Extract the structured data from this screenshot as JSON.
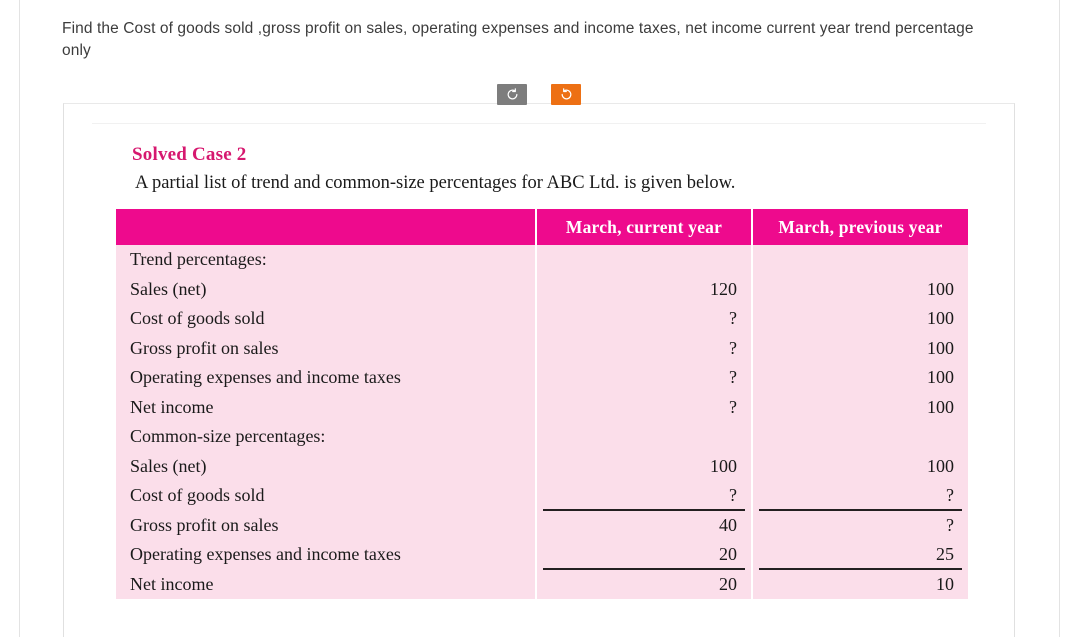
{
  "prompt": {
    "text": "Find the Cost of goods sold ,gross profit on sales, operating expenses and income taxes, net income current year trend percentage only"
  },
  "toolbar": {
    "buttons": [
      {
        "name": "rotate-left-button",
        "icon": "rotate-left-icon",
        "color": "#7d7d7d",
        "label": ""
      },
      {
        "name": "rotate-right-button",
        "icon": "rotate-right-icon",
        "color": "#ed7014",
        "label": ""
      }
    ]
  },
  "card": {
    "case_title": "Solved Case 2",
    "case_subtitle": "A partial list of trend and common-size percentages for ABC Ltd. is given below."
  },
  "table": {
    "headers": [
      "",
      "March, current year",
      "March, previous year"
    ],
    "accent_header_color": "#ee0a8d",
    "body_color": "#fbdeea",
    "rows": [
      {
        "label": "Trend percentages:",
        "indent": 0,
        "current": "",
        "previous": "",
        "rule": false
      },
      {
        "label": "Sales (net)",
        "indent": 1,
        "current": "120",
        "previous": "100",
        "rule": false
      },
      {
        "label": "Cost of goods sold",
        "indent": 1,
        "current": "?",
        "previous": "100",
        "rule": false
      },
      {
        "label": "Gross profit on sales",
        "indent": 1,
        "current": "?",
        "previous": "100",
        "rule": false
      },
      {
        "label": "Operating expenses and income taxes",
        "indent": 1,
        "current": "?",
        "previous": "100",
        "rule": false
      },
      {
        "label": "Net income",
        "indent": 1,
        "current": "?",
        "previous": "100",
        "rule": false
      },
      {
        "label": "Common-size percentages:",
        "indent": 0,
        "current": "",
        "previous": "",
        "rule": false
      },
      {
        "label": "Sales (net)",
        "indent": 1,
        "current": "100",
        "previous": "100",
        "rule": false
      },
      {
        "label": "Cost of goods sold",
        "indent": 1,
        "current": "?",
        "previous": "?",
        "rule": true
      },
      {
        "label": "Gross profit on sales",
        "indent": 1,
        "current": "40",
        "previous": "?",
        "rule": false
      },
      {
        "label": "Operating expenses and income taxes",
        "indent": 1,
        "current": "20",
        "previous": "25",
        "rule": true
      },
      {
        "label": "Net income",
        "indent": 0,
        "current": "20",
        "previous": "10",
        "rule": false
      }
    ]
  }
}
